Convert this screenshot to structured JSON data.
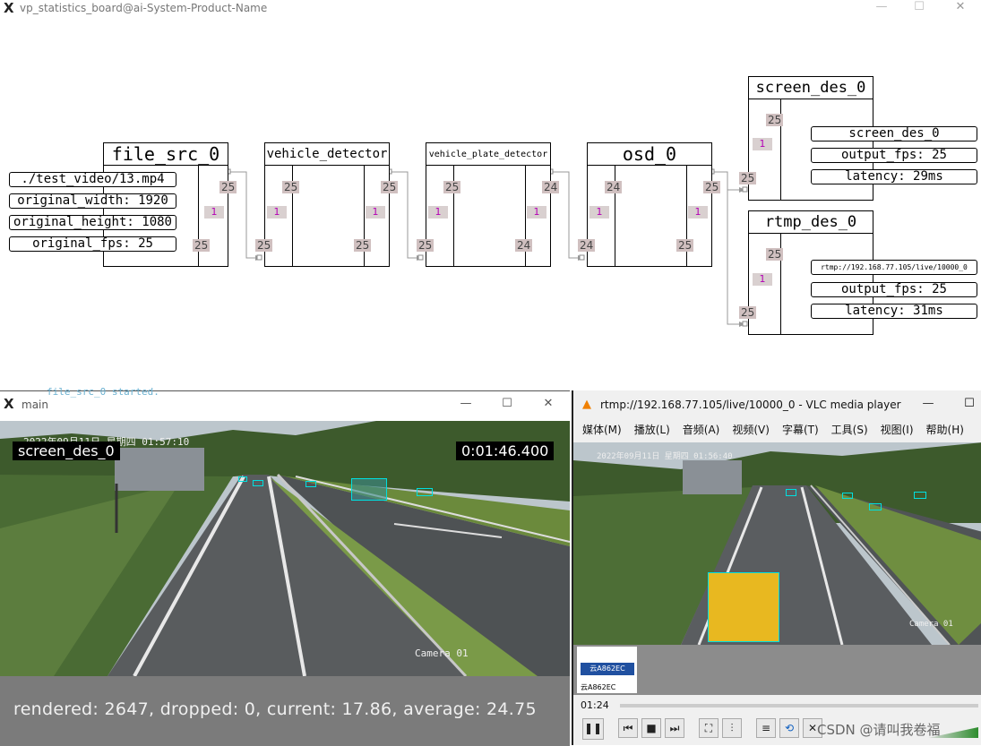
{
  "board": {
    "title": "vp_statistics_board@ai-System-Product-Name",
    "nodes": {
      "file_src": {
        "name": "file_src_0",
        "in": "25",
        "out": "25",
        "mid": "1",
        "out2": "25"
      },
      "vehicle_detector": {
        "name": "vehicle_detector",
        "in": "25",
        "left": "25",
        "right_top": "25",
        "mid": "1",
        "right_mid": "1",
        "bottom_right": "25"
      },
      "plate_detector": {
        "name": "vehicle_plate_detector",
        "in": "25",
        "left": "25",
        "right_top": "24",
        "mid": "1",
        "right_mid": "1",
        "bottom_right": "24"
      },
      "osd": {
        "name": "osd_0",
        "in": "24",
        "left": "24",
        "right_top": "25",
        "mid": "1",
        "right_mid": "1",
        "bottom_right": "25"
      },
      "screen_des": {
        "name": "screen_des_0",
        "in": "25",
        "top": "25",
        "mid": "1"
      },
      "rtmp_des": {
        "name": "rtmp_des_0",
        "in": "25",
        "top": "25",
        "mid": "1"
      }
    },
    "file_info": [
      "./test_video/13.mp4",
      "original_width: 1920",
      "original_height: 1080",
      "original_fps: 25"
    ],
    "screen_info": [
      "screen_des_0",
      "output_fps: 25",
      "latency: 29ms"
    ],
    "rtmp_info": [
      "rtmp://192.168.77.105/live/10000_0",
      "output_fps: 25",
      "latency: 31ms"
    ]
  },
  "main_window": {
    "title": "main",
    "overlay_label": "screen_des_0",
    "timer": "0:01:46.400",
    "camera_ts": "2022年09月11日 星期四 01:57:10",
    "camera_label": "Camera 01",
    "stats": "rendered: 2647, dropped: 0, current: 17.86, average: 24.75",
    "bg_text": "file_src_0 started."
  },
  "vlc": {
    "title": "rtmp://192.168.77.105/live/10000_0 - VLC media player",
    "menu": [
      "媒体(M)",
      "播放(L)",
      "音频(A)",
      "视频(V)",
      "字幕(T)",
      "工具(S)",
      "视图(I)",
      "帮助(H)"
    ],
    "camera_ts": "2022年09月11日 星期四 01:56:40",
    "plate_text": "云A862EC",
    "plate_caption": "云A862EC",
    "time": "01:24",
    "watermark": "CSDN @请叫我卷福",
    "camera_label": "Camera 01"
  },
  "colors": {
    "badge": "#d0c0c0",
    "magenta": "#b400b4",
    "bbox": "#00e0e0"
  }
}
